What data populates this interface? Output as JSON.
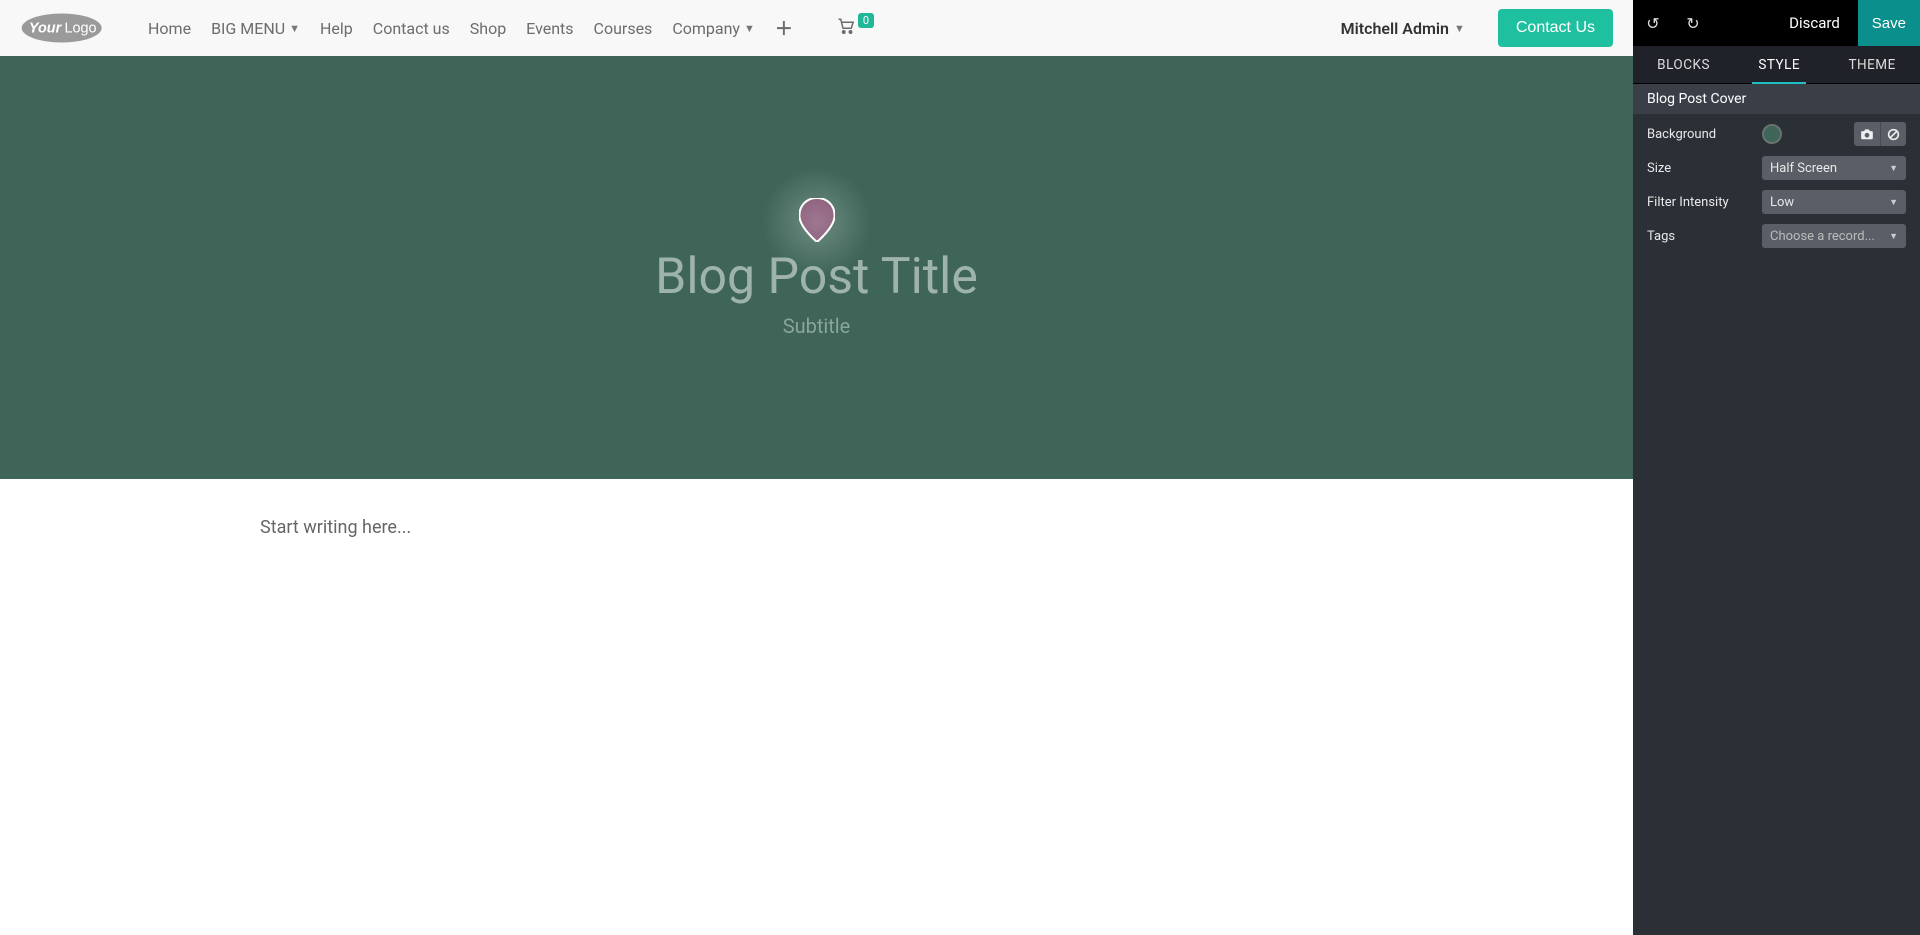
{
  "nav": {
    "home": "Home",
    "big_menu": "BIG MENU",
    "help": "Help",
    "contact": "Contact us",
    "shop": "Shop",
    "events": "Events",
    "courses": "Courses",
    "company": "Company",
    "cart_count": "0",
    "user": "Mitchell Admin",
    "contact_us_btn": "Contact Us"
  },
  "cover": {
    "title": "Blog Post Title",
    "subtitle": "Subtitle"
  },
  "content": {
    "placeholder": "Start writing here..."
  },
  "editor": {
    "discard": "Discard",
    "save": "Save",
    "tabs": {
      "blocks": "BLOCKS",
      "style": "STYLE",
      "theme": "THEME"
    },
    "section_title": "Blog Post Cover",
    "background_label": "Background",
    "background_color": "#3e6558",
    "size_label": "Size",
    "size_value": "Half Screen",
    "filter_label": "Filter Intensity",
    "filter_value": "Low",
    "tags_label": "Tags",
    "tags_placeholder": "Choose a record..."
  }
}
